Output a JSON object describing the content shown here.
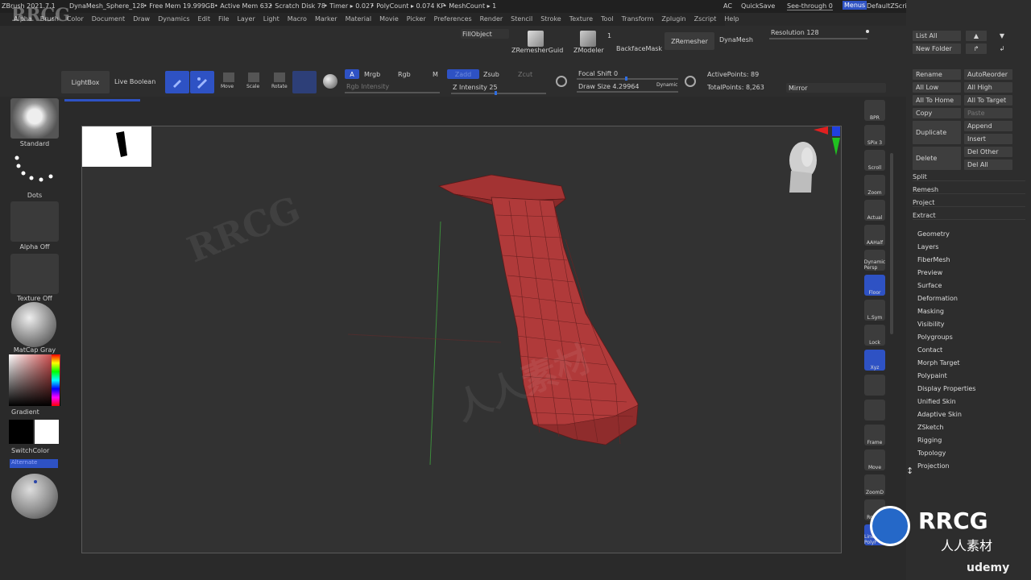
{
  "titlebar": {
    "app": "ZBrush 2021.7.1",
    "file": "DynaMesh_Sphere_128",
    "free_mem": "• Free Mem 19.999GB",
    "active_mem": "• Active Mem 632",
    "scratch": "• Scratch Disk 78",
    "timer": "• Timer ▸ 0.027",
    "polycount": "• PolyCount ▸ 0.074 KP",
    "meshcount": "• MeshCount ▸ 1",
    "ac": "AC",
    "quicksave": "QuickSave",
    "seethrough": "See-through  0",
    "menus_btn": "Menus",
    "defaultzscript": "DefaultZScript"
  },
  "menubar": [
    "Alpha",
    "Brush",
    "Color",
    "Document",
    "Draw",
    "Dynamics",
    "Edit",
    "File",
    "Layer",
    "Light",
    "Macro",
    "Marker",
    "Material",
    "Movie",
    "Picker",
    "Preferences",
    "Render",
    "Stencil",
    "Stroke",
    "Texture",
    "Tool",
    "Transform",
    "Zplugin",
    "Zscript",
    "Help"
  ],
  "shelf": {
    "lightbox": "LightBox",
    "live_boolean": "Live Boolean",
    "move": "Move",
    "scale": "Scale",
    "rotate": "Rotate",
    "a": "A",
    "mrgb": "Mrgb",
    "rgb": "Rgb",
    "m": "M",
    "rgb_intensity": "Rgb Intensity",
    "zadd": "Zadd",
    "zsub": "Zsub",
    "zcut": "Zcut",
    "z_intensity": "Z Intensity 25",
    "focal_shift": "Focal Shift 0",
    "draw_size": "Draw Size 4.29964",
    "dynamic": "Dynamic",
    "active_points": "ActivePoints: 89",
    "total_points": "TotalPoints: 8,263",
    "fillobject": "FillObject",
    "zremesher_guide": "ZRemesherGuid",
    "zmodeler": "ZModeler",
    "zmodeler_num": "1",
    "backfacemask": "BackfaceMask",
    "zremesher": "ZRemesher",
    "dynamesh": "DynaMesh",
    "resolution": "Resolution 128",
    "mirror": "Mirror"
  },
  "lefttray": {
    "brush": "Standard",
    "stroke": "Dots",
    "alpha": "Alpha Off",
    "texture": "Texture Off",
    "material": "MatCap Gray",
    "gradient": "Gradient",
    "switchcolor": "SwitchColor",
    "alternate": "Alternate"
  },
  "righttools": [
    "BPR",
    "SPix 3",
    "Scroll",
    "Zoom",
    "Actual",
    "AAHalf",
    "Dynamic Persp",
    "Floor",
    "L.Sym",
    "Lock",
    "Xyz",
    "",
    "",
    "Frame",
    "Move",
    "ZoomD",
    "Rotate",
    "Line Fill PolyF"
  ],
  "rightpanel": {
    "list_all": "List All",
    "new_folder": "New Folder",
    "rename": "Rename",
    "autoreorder": "AutoReorder",
    "all_low": "All Low",
    "all_high": "All High",
    "all_to_home": "All To Home",
    "all_to_target": "All To Target",
    "copy": "Copy",
    "paste": "Paste",
    "duplicate": "Duplicate",
    "append": "Append",
    "insert": "Insert",
    "delete": "Delete",
    "del_other": "Del Other",
    "del_all": "Del All",
    "sections": [
      "Split",
      "Remesh",
      "Project",
      "Extract"
    ],
    "items": [
      "Geometry",
      "Layers",
      "FiberMesh",
      "Preview",
      "Surface",
      "Deformation",
      "Masking",
      "Visibility",
      "Polygroups",
      "Contact",
      "Morph Target",
      "Polypaint",
      "Display Properties",
      "Unified Skin",
      "Adaptive Skin",
      "ZSketch",
      "Rigging",
      "Topology",
      "Projection"
    ]
  },
  "overlay": {
    "logo_big": "RRCG",
    "logo_small": "人人素材",
    "watermark_top": "RRCG",
    "udemy": "udemy"
  },
  "colors": {
    "accent": "#2e52c4",
    "mesh": "#b03a3a",
    "background": "#2a2a2a"
  }
}
